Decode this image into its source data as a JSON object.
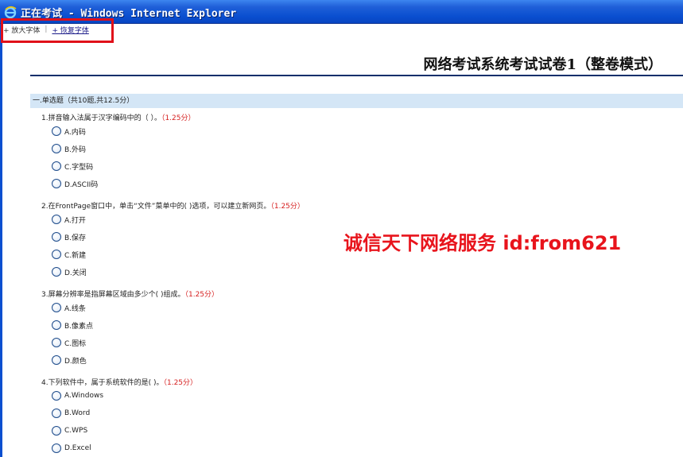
{
  "window": {
    "title": "正在考试 - Windows Internet Explorer"
  },
  "toolbar": {
    "enlarge_font": "+ 放大字体",
    "separator": "|",
    "restore_font": "+ 恢复字体"
  },
  "exam": {
    "title": "网络考试系统考试试卷1（整卷模式）",
    "section": "一.单选题（共10题,共12.5分）"
  },
  "questions": [
    {
      "text": "1.拼音输入法属于汉字编码中的（ ）。",
      "score": "（1.25分）",
      "options": [
        "A.内码",
        "B.外码",
        "C.字型码",
        "D.ASCII码"
      ]
    },
    {
      "text": "2.在FrontPage窗口中，单击“文件”菜单中的( )选项，可以建立新网页。",
      "score": "（1.25分）",
      "options": [
        "A.打开",
        "B.保存",
        "C.新建",
        "D.关闭"
      ]
    },
    {
      "text": "3.屏幕分辨率是指屏幕区域由多少个( )组成。",
      "score": "（1.25分）",
      "options": [
        "A.线条",
        "B.像素点",
        "C.图标",
        "D.颜色"
      ]
    },
    {
      "text": "4.下列软件中，属于系统软件的是( )。",
      "score": "（1.25分）",
      "options": [
        "A.Windows",
        "B.Word",
        "C.WPS",
        "D.Excel"
      ]
    }
  ],
  "watermark": "诚信天下网络服务 id:from621",
  "icons": {
    "browser": "internet-explorer-icon",
    "radio": "radio-button-icon"
  },
  "colors": {
    "titlebar": "#0a4fd0",
    "highlight": "#e0101a",
    "score": "#d62020",
    "section_bg": "#d4e6f6",
    "watermark": "#e8141c"
  }
}
